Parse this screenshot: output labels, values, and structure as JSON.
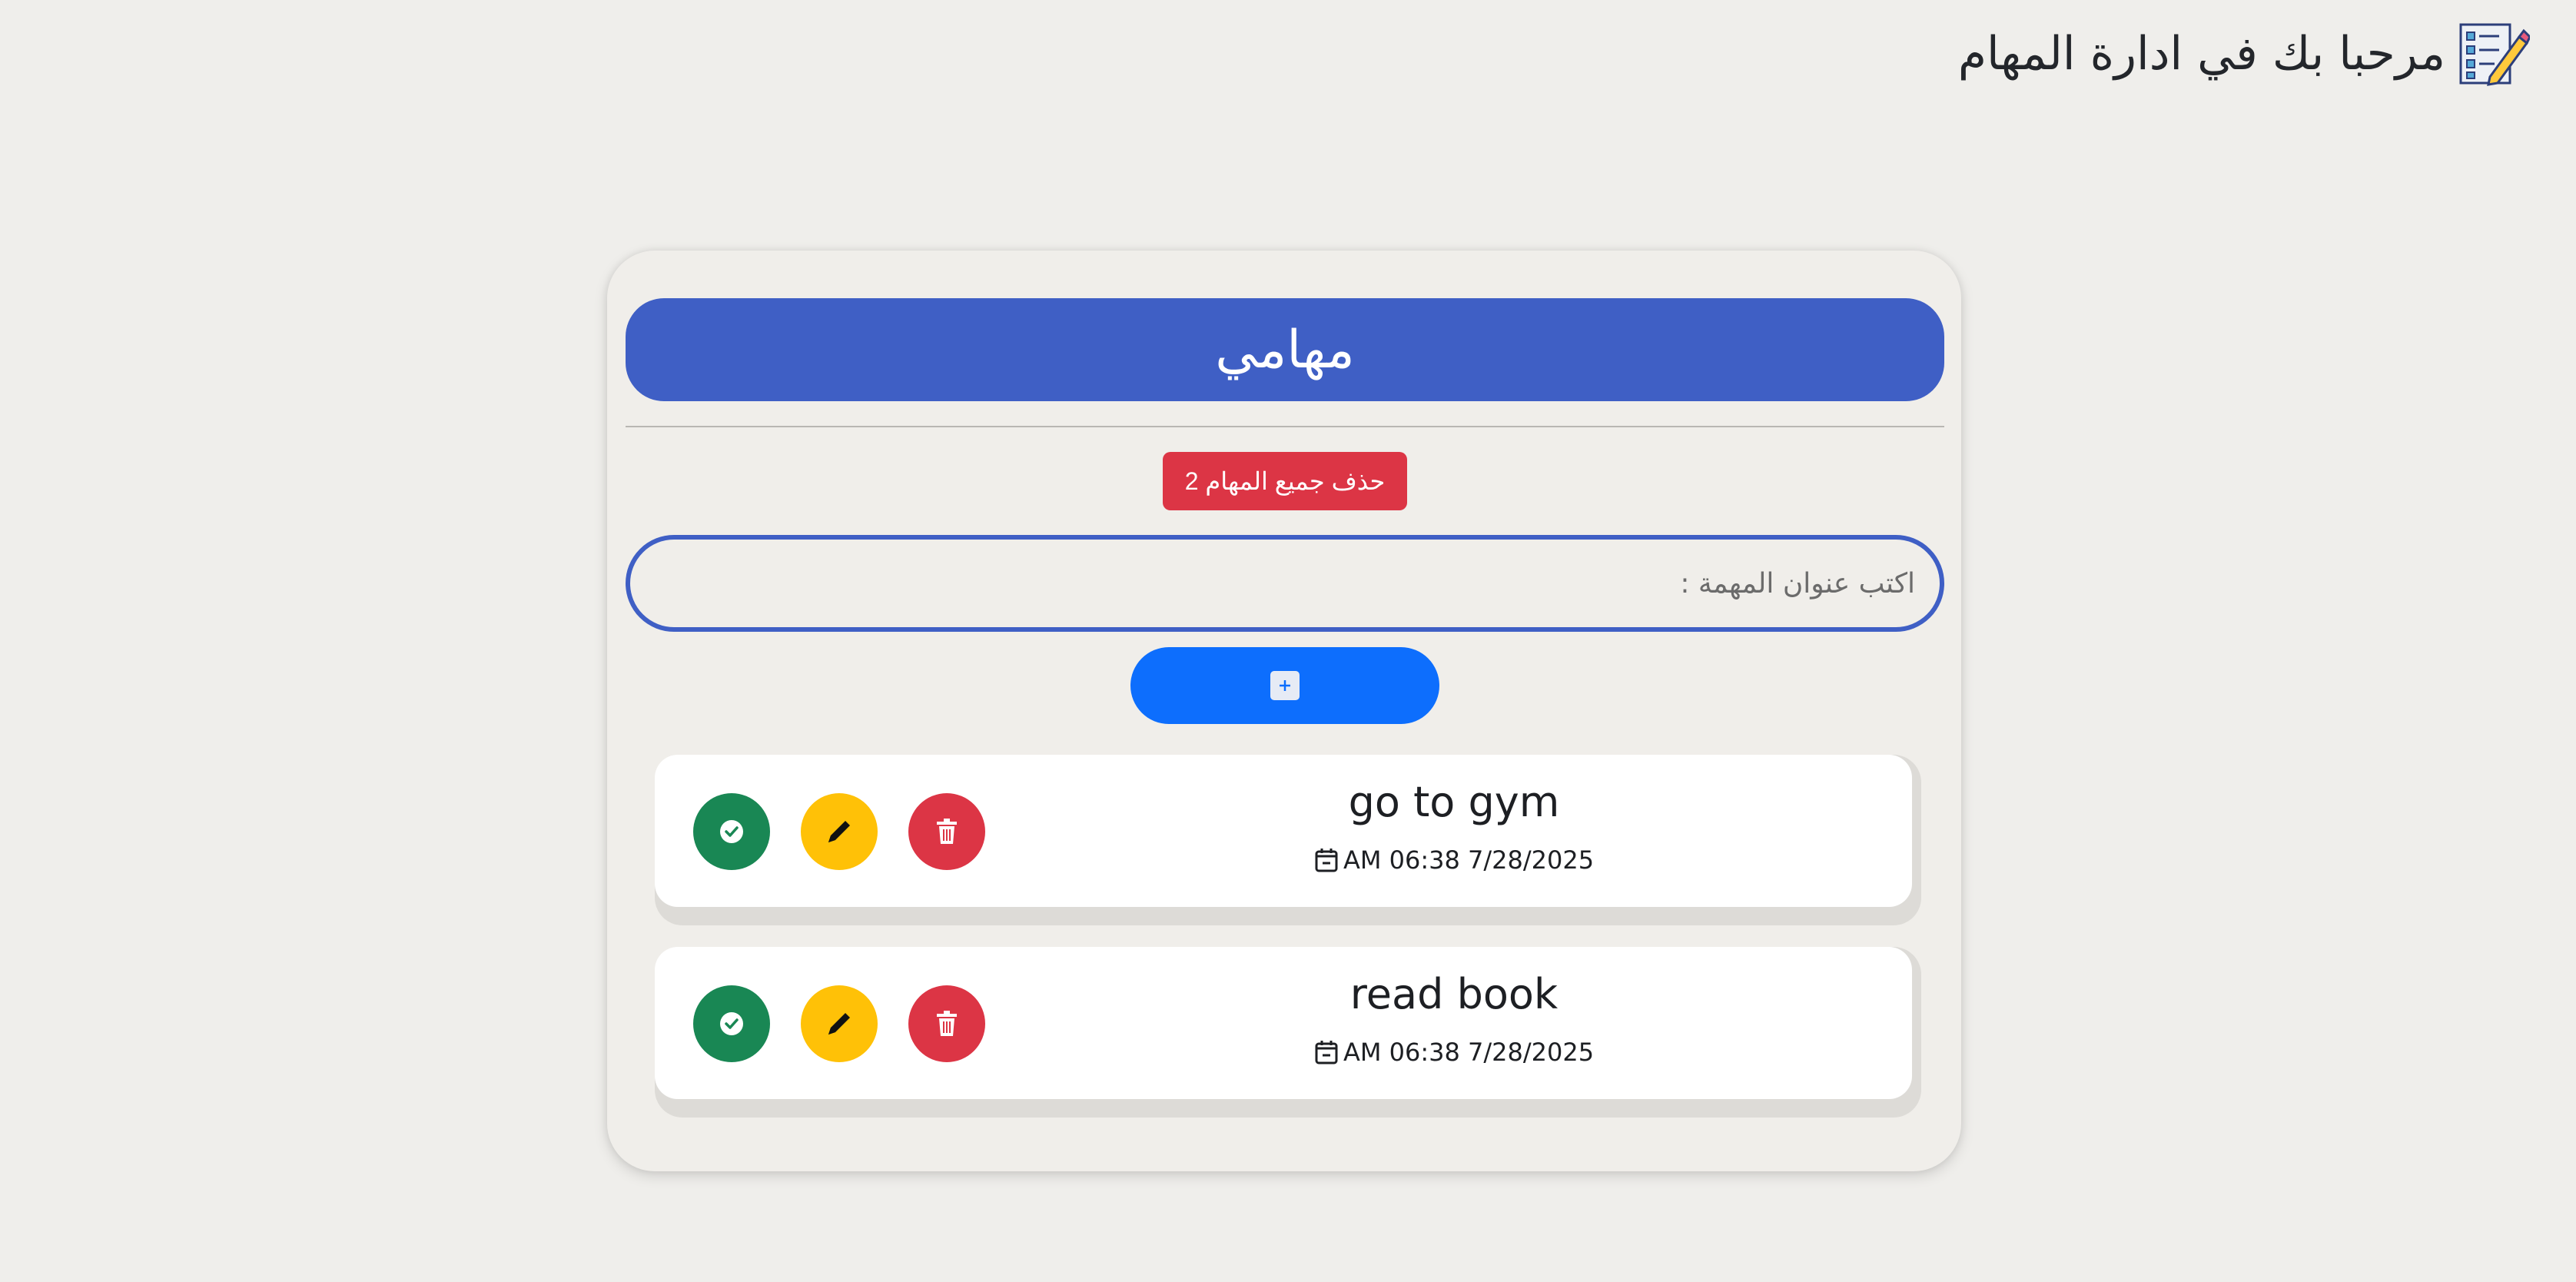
{
  "header": {
    "title": "مرحبا بك في ادارة المهام"
  },
  "card": {
    "title": "مهامي"
  },
  "delete_all": {
    "label": "حذف جميع المهام 2"
  },
  "task_input": {
    "value": "",
    "placeholder": "اكتب عنوان المهمة :"
  },
  "add_button": {
    "icon": "plus-square-icon"
  },
  "tasks": [
    {
      "title": "go to gym",
      "date": "AM 06:38 7/28/2025"
    },
    {
      "title": "read book",
      "date": "AM 06:38 7/28/2025"
    }
  ],
  "colors": {
    "primary": "#3f5fc5",
    "add": "#0d6efd",
    "danger": "#dc3545",
    "warning": "#ffc107",
    "success": "#198754",
    "background": "#efeeeb"
  }
}
